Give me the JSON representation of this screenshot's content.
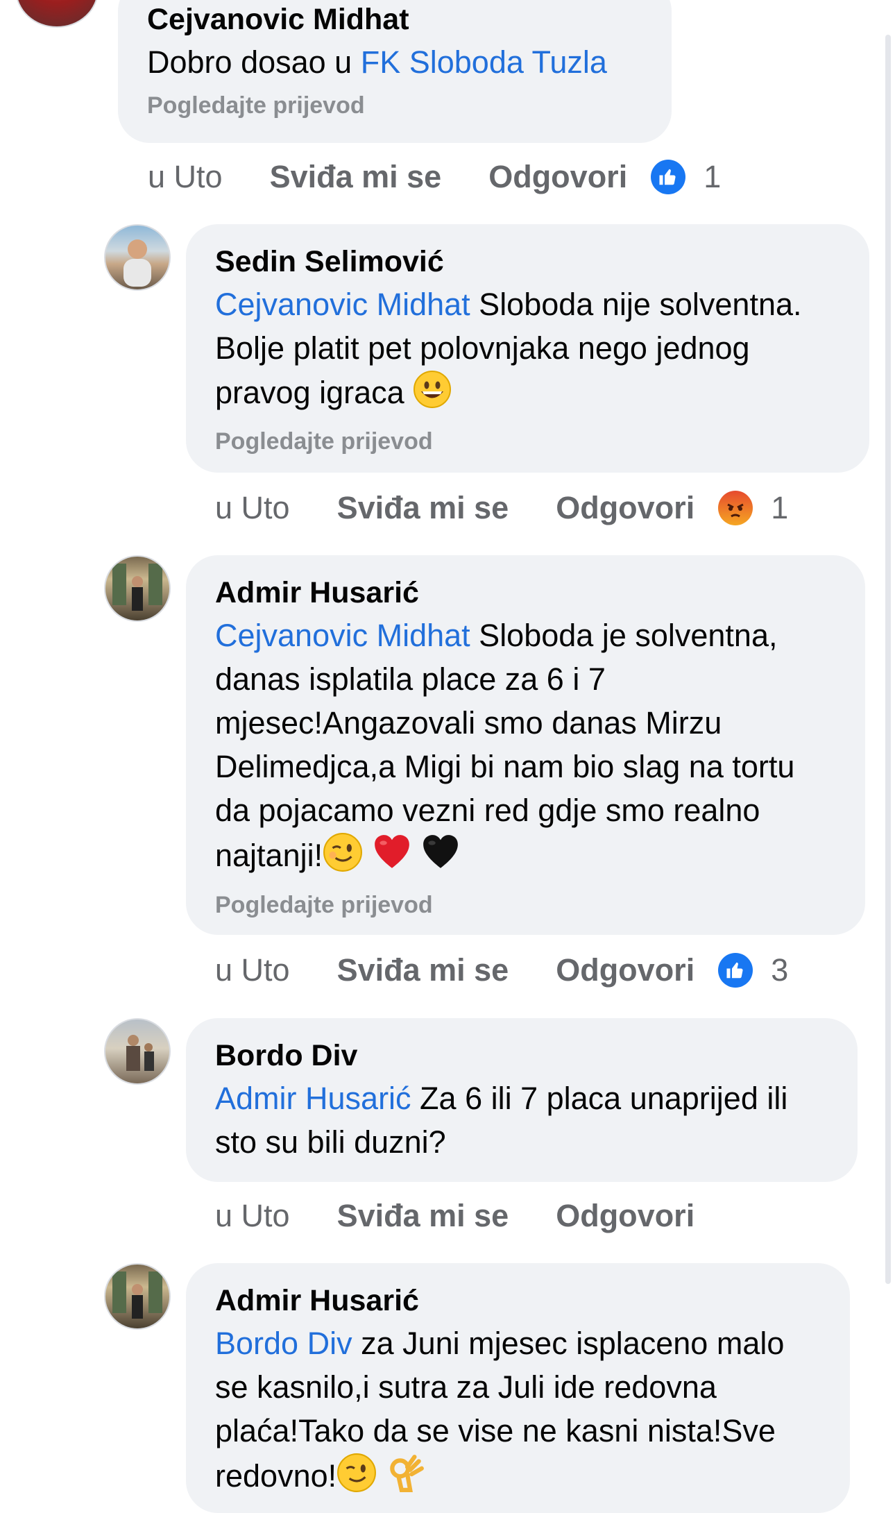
{
  "comments": [
    {
      "author": "Cejvanovic Midhat",
      "text_before": "Dobro dosao  u ",
      "mention": "FK Sloboda Tuzla",
      "text_after": "",
      "translate": "Pogledajte prijevod",
      "time": "u Uto",
      "like": "Sviđa mi se",
      "reply": "Odgovori",
      "reaction": "like-icon",
      "reaction_count": "1"
    },
    {
      "author": "Sedin Selimović",
      "mention": "Cejvanovic Midhat",
      "text": " Sloboda nije solventna. Bolje platit pet polovnjaka nego jednog pravog igraca",
      "translate": "Pogledajte prijevod",
      "time": "u Uto",
      "like": "Sviđa mi se",
      "reply": "Odgovori",
      "reaction": "angry-icon",
      "reaction_count": "1"
    },
    {
      "author": "Admir Husarić",
      "mention": "Cejvanovic Midhat",
      "text": " Sloboda je solventna, danas isplatila place za 6 i 7 mjesec!Angazovali  smo danas Mirzu Delimedjca,a Migi bi nam bio slag na tortu da pojacamo vezni red gdje smo realno najtanji!",
      "translate": "Pogledajte prijevod",
      "time": "u Uto",
      "like": "Sviđa mi se",
      "reply": "Odgovori",
      "reaction": "like-icon",
      "reaction_count": "3"
    },
    {
      "author": "Bordo Div",
      "mention": "Admir Husarić",
      "text": " Za 6 ili 7 placa unaprijed ili sto su bili duzni?",
      "time": "u Uto",
      "like": "Sviđa mi se",
      "reply": "Odgovori"
    },
    {
      "author": "Admir Husarić",
      "mention": "Bordo Div",
      "text": " za Juni mjesec isplaceno malo se kasnilo,i sutra za Juli ide redovna plaća!Tako da se vise ne kasni nista!Sve redovno!"
    }
  ],
  "colors": {
    "bubble": "#f0f2f5",
    "mention": "#216fdb",
    "like_blue": "#1877f2",
    "angry_orange": "#e9710f"
  }
}
